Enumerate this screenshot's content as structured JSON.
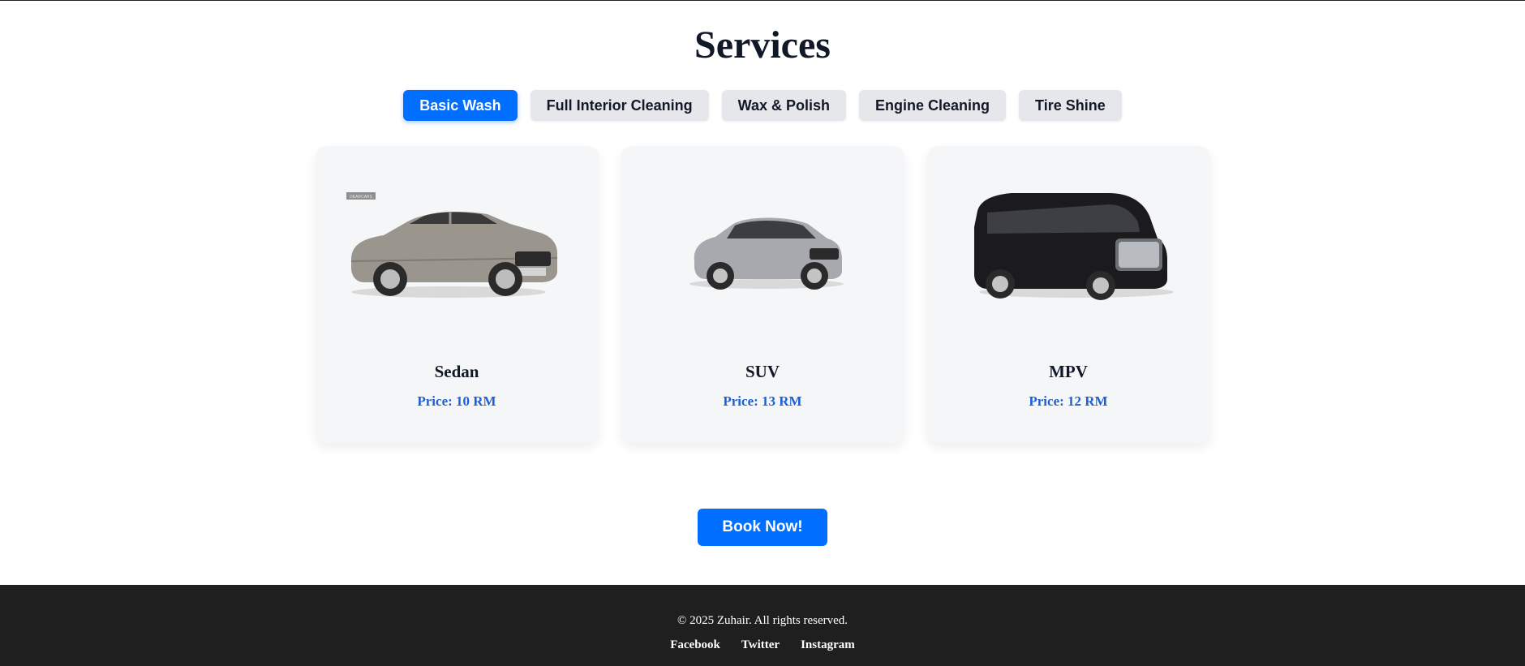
{
  "page": {
    "title": "Services"
  },
  "tabs": [
    {
      "label": "Basic Wash",
      "active": true
    },
    {
      "label": "Full Interior Cleaning",
      "active": false
    },
    {
      "label": "Wax & Polish",
      "active": false
    },
    {
      "label": "Engine Cleaning",
      "active": false
    },
    {
      "label": "Tire Shine",
      "active": false
    }
  ],
  "cards": [
    {
      "name": "Sedan",
      "price": "Price: 10 RM",
      "image_icon": "sedan-car-image",
      "color": "#9a958d",
      "badge": "DEARCARS"
    },
    {
      "name": "SUV",
      "price": "Price: 13 RM",
      "image_icon": "suv-car-image",
      "color": "#a7a9ae"
    },
    {
      "name": "MPV",
      "price": "Price: 12 RM",
      "image_icon": "mpv-car-image",
      "color": "#1b1b1d"
    }
  ],
  "cta": {
    "label": "Book Now!"
  },
  "footer": {
    "copyright": "© 2025 Zuhair. All rights reserved.",
    "links": [
      "Facebook",
      "Twitter",
      "Instagram"
    ]
  },
  "colors": {
    "accent": "#006eff",
    "price": "#1c5fd6",
    "footer_bg": "#1f1f1f",
    "tab_bg": "#e5e7eb",
    "card_bg": "#f5f6f8"
  }
}
